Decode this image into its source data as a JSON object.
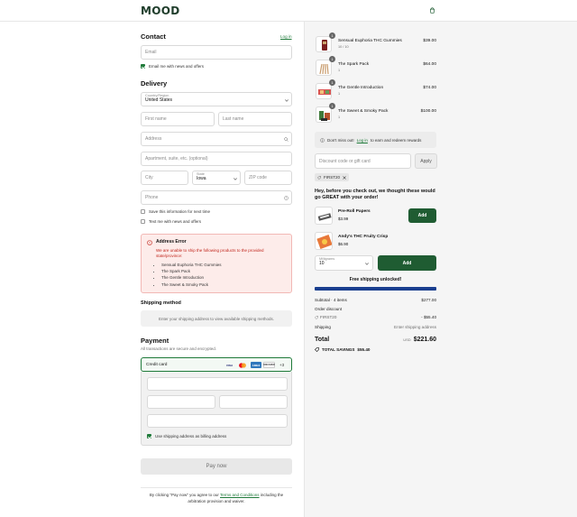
{
  "header": {
    "logo": "MOOD",
    "cart_icon": "shopping-bag-icon"
  },
  "contact": {
    "title": "Contact",
    "login_link": "Log in",
    "email_placeholder": "Email",
    "email_news_label": "Email me with news and offers"
  },
  "delivery": {
    "title": "Delivery",
    "country_label": "Country/Region",
    "country_value": "United States",
    "first_name_placeholder": "First name",
    "last_name_placeholder": "Last name",
    "address_placeholder": "Address",
    "apartment_placeholder": "Apartment, suite, etc. (optional)",
    "city_placeholder": "City",
    "state_label": "State",
    "state_value": "Iowa",
    "zip_placeholder": "ZIP code",
    "phone_placeholder": "Phone",
    "save_info_label": "Save this information for next time",
    "text_news_label": "Text me with news and offers"
  },
  "address_error": {
    "title": "Address Error",
    "message": "We are unable to ship the following products to the provided state/province:",
    "items": [
      "Sensual Euphoria THC Gummies",
      "The Spark Pack",
      "The Gentle Introduction",
      "The Sweet & Smoky Pack"
    ]
  },
  "shipping": {
    "title": "Shipping method",
    "message": "Enter your shipping address to view available shipping methods."
  },
  "payment": {
    "title": "Payment",
    "subtitle": "All transactions are secure and encrypted.",
    "method_label": "Credit card",
    "brands": [
      "VISA",
      "MC",
      "AMEX",
      "DISCOVER"
    ],
    "more_brands": "+3",
    "billing_label": "Use shipping address as billing address",
    "pay_button": "Pay now",
    "terms_pre": "By clicking \"Pay now\" you agree to our",
    "terms_link": "Terms and Conditions",
    "terms_post": "including the arbitration provision and waiver."
  },
  "cart": {
    "items": [
      {
        "name": "Sensual Euphoria THC Gummies",
        "variant": "10 / 10",
        "price": "$39.00",
        "qty": "1"
      },
      {
        "name": "The Spark Pack",
        "variant": "1",
        "price": "$64.00",
        "qty": "1"
      },
      {
        "name": "The Gentle Introduction",
        "variant": "1",
        "price": "$74.00",
        "qty": "1"
      },
      {
        "name": "The Sweet & Smoky Pack",
        "variant": "1",
        "price": "$100.00",
        "qty": "1"
      }
    ],
    "rewards_pre": "Don't miss out!",
    "rewards_link": "Log in",
    "rewards_post": "to earn and redeem rewards",
    "discount_placeholder": "Discount code or gift card",
    "apply_button": "Apply",
    "applied_code": "FIRST20",
    "upsell_title": "Hey, before you check out, we thought these would go GREAT with your order!",
    "upsell": [
      {
        "name": "Pre-Roll Papers",
        "price": "$3.99",
        "button": "Add"
      },
      {
        "name": "Andy's THC Fruity Crisp",
        "price": "$6.90",
        "button": "Add"
      }
    ],
    "milligrams_label": "Milligrams",
    "milligrams_value": "10",
    "free_shipping": "Free shipping unlocked!",
    "free_shipping_progress": 1.0
  },
  "summary": {
    "subtotal_label": "Subtotal · 4 items",
    "subtotal_value": "$277.00",
    "order_discount_label": "Order discount",
    "discount_code": "FIRST20",
    "discount_value": "- $55.40",
    "shipping_label": "Shipping",
    "shipping_value": "Enter shipping address",
    "total_label": "Total",
    "currency": "USD",
    "total_value": "$221.60",
    "savings_label": "TOTAL SAVINGS",
    "savings_value": "$55.40"
  },
  "colors": {
    "brand_green": "#1f5c32",
    "accent_green": "#1f7a3a",
    "error_red": "#c1271d",
    "progress_blue": "#1a3f8f"
  }
}
